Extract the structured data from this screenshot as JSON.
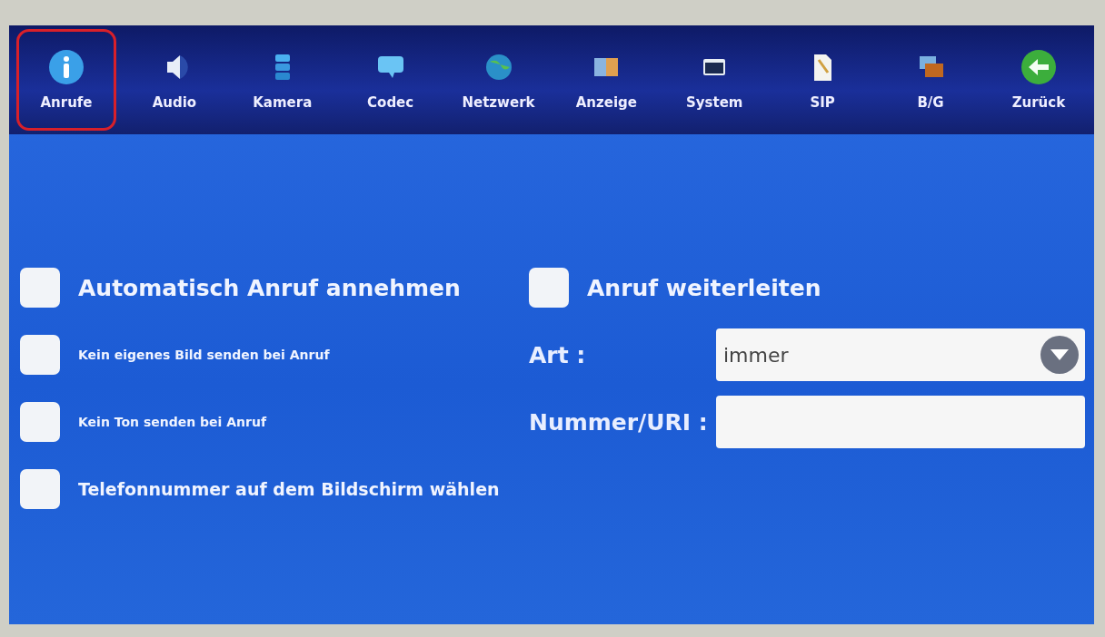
{
  "toolbar": {
    "items": [
      {
        "label": "Anrufe",
        "kind": "info",
        "selected": true
      },
      {
        "label": "Audio",
        "kind": "speaker",
        "selected": false
      },
      {
        "label": "Kamera",
        "kind": "stack",
        "selected": false
      },
      {
        "label": "Codec",
        "kind": "bubble",
        "selected": false
      },
      {
        "label": "Netzwerk",
        "kind": "globe",
        "selected": false
      },
      {
        "label": "Anzeige",
        "kind": "picture",
        "selected": false
      },
      {
        "label": "System",
        "kind": "window",
        "selected": false
      },
      {
        "label": "SIP",
        "kind": "document",
        "selected": false
      },
      {
        "label": "B/G",
        "kind": "photos",
        "selected": false
      },
      {
        "label": "Zurück",
        "kind": "back",
        "selected": false
      }
    ]
  },
  "options": [
    {
      "label": "Automatisch Anruf annehmen",
      "kind": "large",
      "checked": false
    },
    {
      "label": "Kein eigenes Bild senden bei Anruf",
      "kind": "small",
      "checked": false
    },
    {
      "label": "Kein Ton senden bei Anruf",
      "kind": "small",
      "checked": false
    },
    {
      "label": "Telefonnummer auf dem Bildschirm wählen",
      "kind": "medium",
      "checked": false
    }
  ],
  "forward": {
    "label": "Anruf weiterleiten",
    "checked": false
  },
  "type_field": {
    "label": "Art :",
    "value": "immer"
  },
  "number_field": {
    "label": "Nummer/URI :"
  }
}
